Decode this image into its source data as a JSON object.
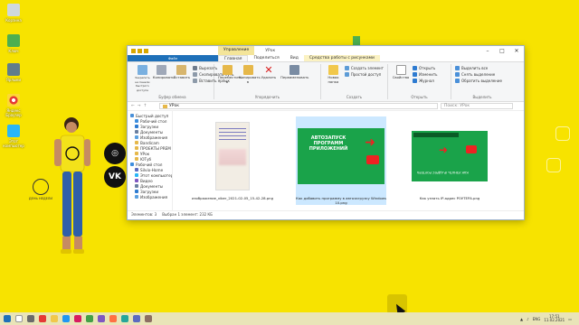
{
  "desktop": {
    "icons": [
      {
        "label": "Корзина"
      },
      {
        "label": "Ключ"
      },
      {
        "label": "Ярлыки"
      },
      {
        "label": "Яндекс Браузер"
      },
      {
        "label": "Этот компьютер"
      }
    ],
    "clock_label": "ДЕНЬ НЕДЕЛИ",
    "social": {
      "ig": "◎",
      "vk": "VK"
    }
  },
  "window": {
    "title": "УРок",
    "context_tab": "Управление",
    "tabs": [
      "Файл",
      "Главная",
      "Поделиться",
      "Вид",
      "Средства работы с рисунками"
    ],
    "ribbon": {
      "clipboard": {
        "pin": "Закрепить на панели быстрого доступа",
        "copy": "Копировать",
        "paste": "Вставить",
        "cut": "Вырезать",
        "copy_path": "Скопировать путь",
        "paste_shortcut": "Вставить ярлык",
        "group": "Буфер обмена"
      },
      "organize": {
        "move": "Переместить в",
        "copyto": "Копировать в",
        "delete": "Удалить",
        "rename": "Переименовать",
        "group": "Упорядочить"
      },
      "create": {
        "newfolder": "Новая папка",
        "new_item": "Создать элемент",
        "easy_access": "Простой доступ",
        "group": "Создать"
      },
      "open": {
        "properties": "Свойства",
        "open": "Открыть",
        "edit": "Изменить",
        "history": "Журнал",
        "group": "Открыть"
      },
      "select": {
        "select_all": "Выделить все",
        "select_none": "Снять выделение",
        "invert": "Обратить выделение",
        "group": "Выделить"
      }
    },
    "address": {
      "path": "УРок",
      "search_placeholder": "Поиск: УРок"
    },
    "nav": [
      {
        "label": "Быстрый доступ",
        "sub": false
      },
      {
        "label": "Рабочий стол",
        "sub": true
      },
      {
        "label": "Загрузки",
        "sub": true
      },
      {
        "label": "Документы",
        "sub": true
      },
      {
        "label": "Изображения",
        "sub": true
      },
      {
        "label": "Bandicam",
        "sub": true
      },
      {
        "label": "ПРОЕКТЫ PREM",
        "sub": true
      },
      {
        "label": "УРок",
        "sub": true
      },
      {
        "label": "ЮTуб",
        "sub": true
      },
      {
        "label": "Рабочий стол",
        "sub": false
      },
      {
        "label": "Silvio-Home",
        "sub": true
      },
      {
        "label": "Этот компьютер",
        "sub": true
      },
      {
        "label": "Видео",
        "sub": true
      },
      {
        "label": "Документы",
        "sub": true
      },
      {
        "label": "Загрузки",
        "sub": true
      },
      {
        "label": "Изображения",
        "sub": true
      }
    ],
    "files": [
      {
        "name": "изображение_viber_2021-02-05_15-42-28.png"
      },
      {
        "name": "Как добавить программу в автозагрузку Windows 10.png",
        "thumb_text": "АВТОЗАПУСК ПРОГРАММ ПРИЛОЖЕНИЙ"
      },
      {
        "name": "Как узнать IP-адрес РОУТЕРА.png",
        "thumb_text": "КАК УЗНАТЬ IP-АДРЕС РОУТЕРА"
      }
    ],
    "status": {
      "count": "Элементов: 3",
      "selected": "Выбран 1 элемент: 232 КБ"
    }
  },
  "taskbar": {
    "lang": "ENG",
    "time": "17:51",
    "date": "11.02.2021"
  },
  "colors": {
    "desktop": "#f7e300",
    "file_tab": "#1e70b9",
    "thumb_green": "#1aa34a"
  }
}
